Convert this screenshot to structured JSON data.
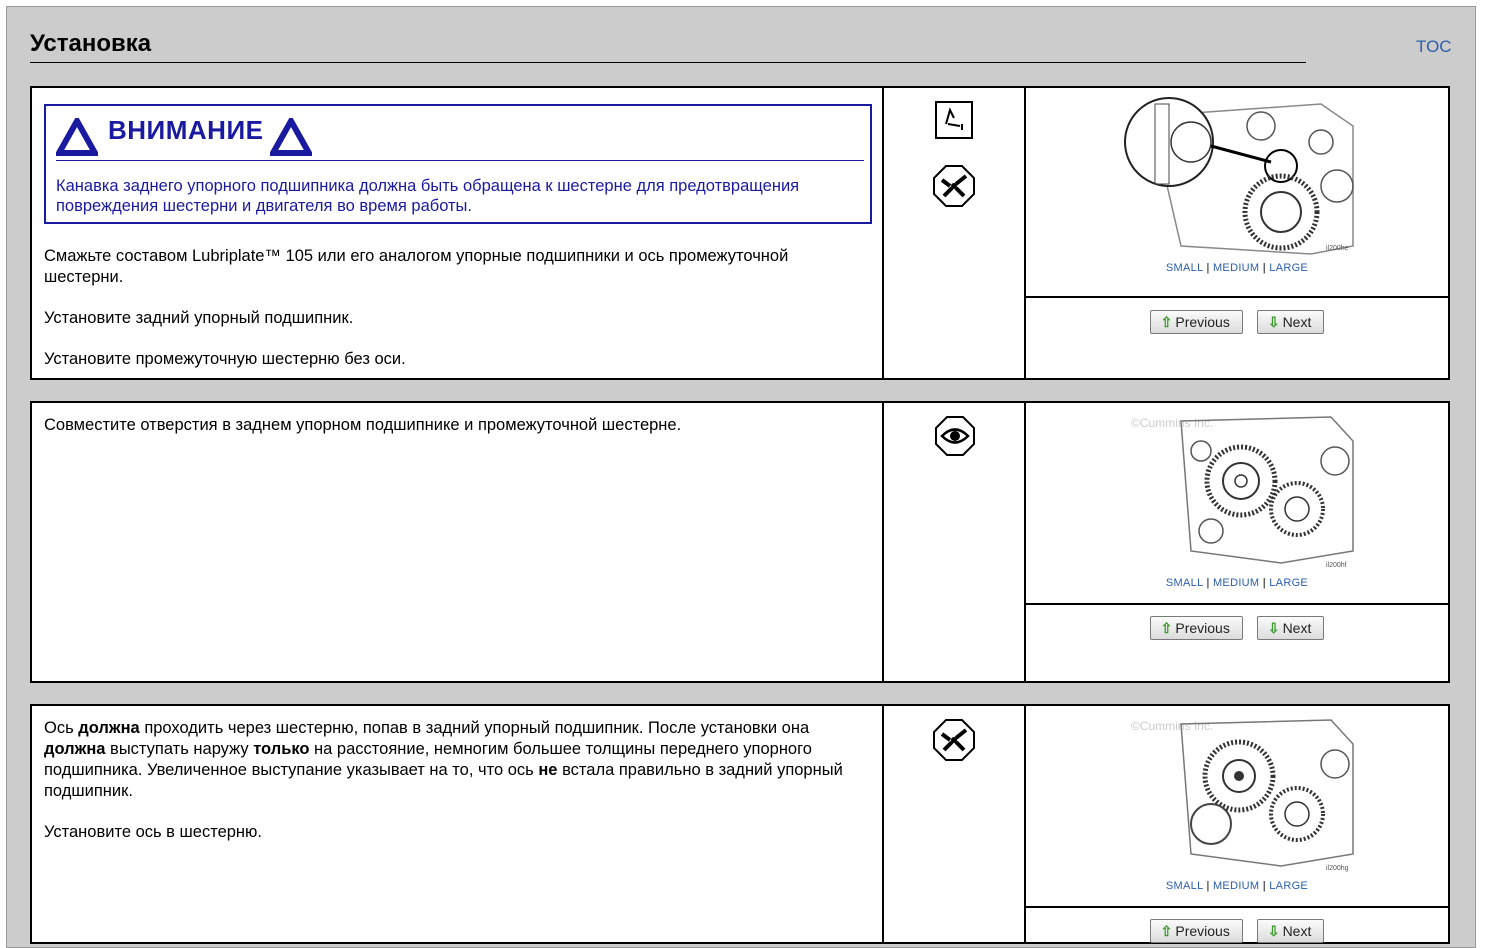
{
  "page": {
    "title": "Установка",
    "toc_label": "TOC"
  },
  "common": {
    "size_small": "SMALL",
    "size_medium": "MEDIUM",
    "size_large": "LARGE",
    "size_sep": " | ",
    "previous_label": "Previous",
    "next_label": "Next"
  },
  "step1": {
    "warning_title": "ВНИМАНИЕ",
    "warning_text": "Канавка заднего упорного подшипника должна быть обращена к шестерне для предотвращения повреждения шестерни и двигателя во время работы.",
    "para1": "Смажьте составом Lubriplate™ 105 или его аналогом упорные подшипники и ось промежуточной шестерни.",
    "para2": "Установите задний упорный подшипник.",
    "para3": "Установите промежуточную шестерню без оси.",
    "icons": [
      "lubricate-icon",
      "tool-icon"
    ],
    "image_code": "il200he"
  },
  "step2": {
    "para1": "Совместите отверстия в заднем упорном подшипнике и промежуточной шестерне.",
    "icons": [
      "inspect-eye-icon"
    ],
    "image_watermark": "©Cummins Inc.",
    "image_code": "il200hf"
  },
  "step3": {
    "p1_a": "Ось ",
    "p1_b": "должна",
    "p1_c": " проходить через шестерню, попав в задний упорный подшипник. После установки она ",
    "p1_d": "должна",
    "p1_e": " выступать наружу ",
    "p1_f": "только",
    "p1_g": " на расстояние, немногим большее толщины переднего упорного подшипника. Увеличенное выступание указывает на то, что ось ",
    "p1_h": "не",
    "p1_i": " встала правильно в задний упорный подшипник.",
    "para2": "Установите ось в шестерню.",
    "icons": [
      "tool-icon"
    ],
    "image_watermark": "©Cummins Inc.",
    "image_code": "il200hg"
  },
  "colors": {
    "frame_bg": "#cccccc",
    "warning_blue": "#1a1aa0",
    "link_blue": "#2a5fae",
    "arrow_green": "#3a9a2a"
  }
}
